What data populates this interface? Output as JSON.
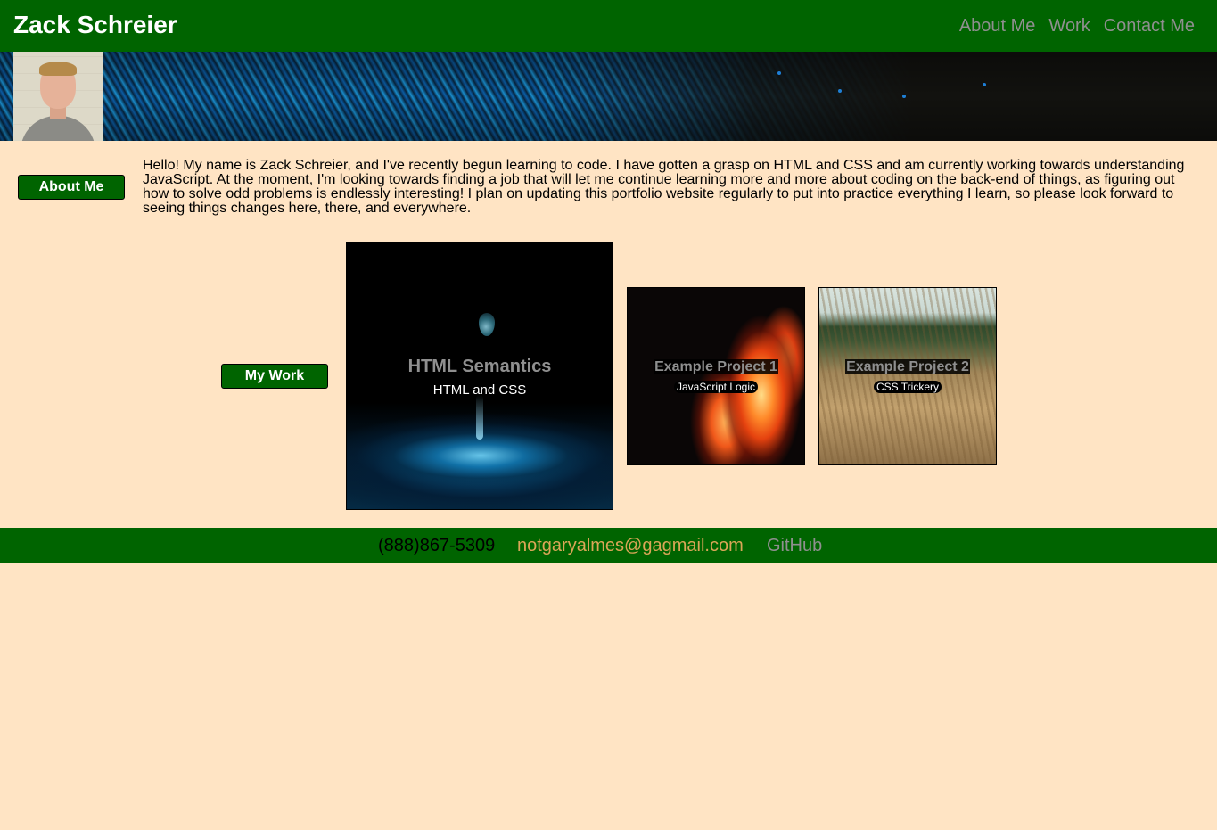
{
  "header": {
    "title": "Zack Schreier",
    "nav": [
      {
        "label": "About Me"
      },
      {
        "label": "Work"
      },
      {
        "label": "Contact Me"
      }
    ]
  },
  "about": {
    "label": "About Me",
    "text": "Hello! My name is Zack Schreier, and I've recently begun learning to code. I have gotten a grasp on HTML and CSS and am currently working towards understanding JavaScript. At the moment, I'm looking towards finding a job that will let me continue learning more and more about coding on the back-end of things, as figuring out how to solve odd problems is endlessly interesting! I plan on updating this portfolio website regularly to put into practice everything I learn, so please look forward to seeing things changes here, there, and everywhere."
  },
  "work": {
    "label": "My Work",
    "projects": [
      {
        "title": "HTML Semantics",
        "subtitle": "HTML and CSS",
        "image": "water-drop"
      },
      {
        "title": "Example Project 1",
        "subtitle": "JavaScript Logic",
        "image": "fire"
      },
      {
        "title": "Example Project 2",
        "subtitle": "CSS Trickery",
        "image": "wheat-field"
      }
    ]
  },
  "footer": {
    "phone": "(888)867-5309",
    "email": "notgaryalmes@gagmail.com",
    "github": "GitHub"
  },
  "colors": {
    "primary": "#006400",
    "background": "#ffe4c4",
    "nav_link": "#8f8f8f",
    "email_link": "#daa657"
  }
}
